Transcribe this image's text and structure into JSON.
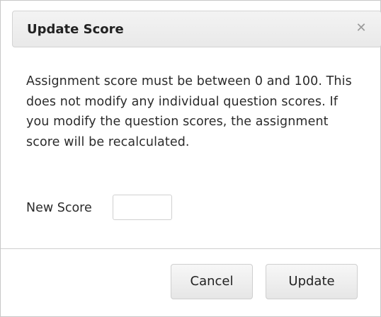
{
  "dialog": {
    "title": "Update Score",
    "close_glyph": "✕",
    "close_icon": "close-icon",
    "message": "Assignment score must be between 0 and 100. This does not modify any individual question scores. If you modify the question scores, the assignment score will be recalculated.",
    "score_label": "New Score",
    "score_value": "",
    "buttons": {
      "cancel": "Cancel",
      "update": "Update"
    }
  }
}
